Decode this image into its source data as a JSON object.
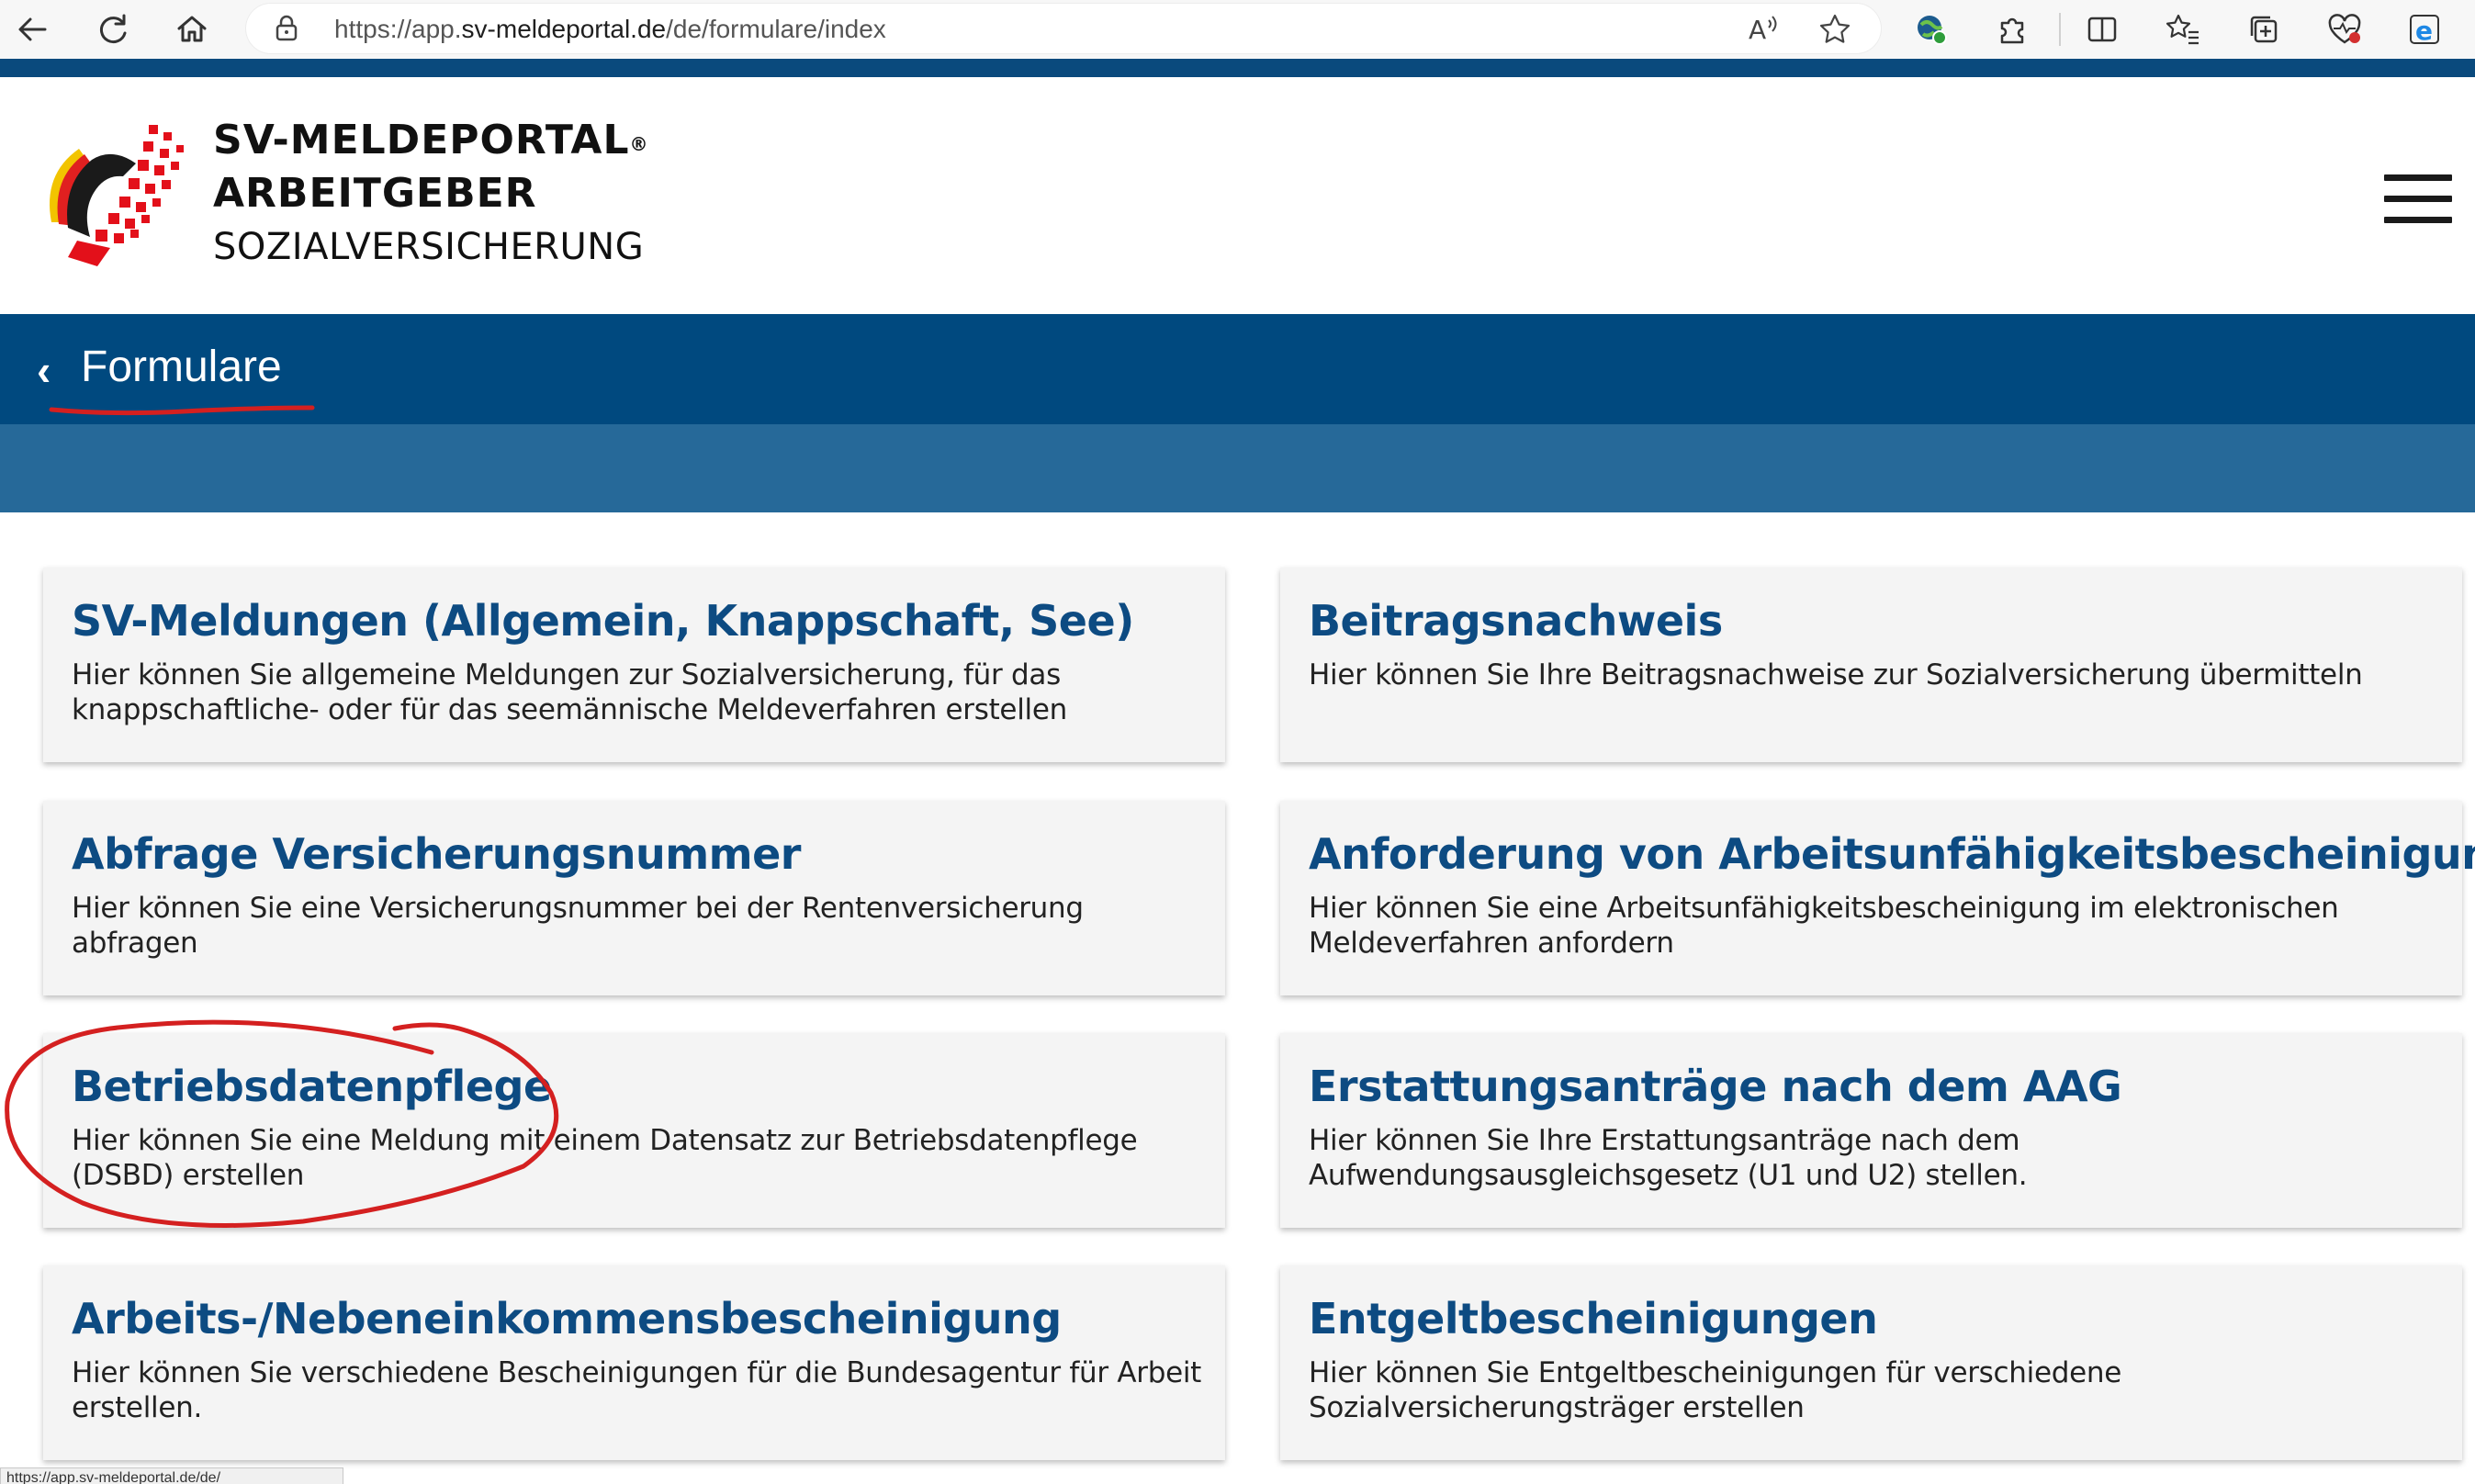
{
  "browser": {
    "url_base": "https://app.",
    "url_host": "sv-meldeportal.de",
    "url_path": "/de/formulare/index",
    "status_url": "https://app.sv-meldeportal.de/de/"
  },
  "header": {
    "brand_line1": "SV-MELDEPORTAL",
    "brand_reg": "®",
    "brand_line2": "ARBEITGEBER",
    "brand_line3": "SOZIALVERSICHERUNG"
  },
  "title_band": {
    "title": "Formulare"
  },
  "cards": [
    {
      "title": "SV-Meldungen (Allgemein, Knappschaft, See)",
      "desc": "Hier können Sie allgemeine Meldungen zur Sozialversicherung, für das knappschaftliche- oder für das seemännische Meldeverfahren erstellen"
    },
    {
      "title": "Beitragsnachweis",
      "desc": "Hier können Sie Ihre Beitragsnachweise zur Sozialversicherung übermitteln"
    },
    {
      "title": "Abfrage Versicherungsnummer",
      "desc": "Hier können Sie eine Versicherungsnummer bei der Rentenversicherung abfragen"
    },
    {
      "title": "Anforderung von Arbeitsunfähigkeitsbescheinigungen",
      "desc": "Hier können Sie eine Arbeitsunfähigkeitsbescheinigung im elektronischen Meldeverfahren anfordern"
    },
    {
      "title": "Betriebsdatenpflege",
      "desc": "Hier können Sie eine Meldung mit einem Datensatz zur Betriebsdatenpflege (DSBD) erstellen"
    },
    {
      "title": "Erstattungsanträge nach dem AAG",
      "desc": "Hier können Sie Ihre Erstattungsanträge nach dem Aufwendungsausgleichsgesetz (U1 und U2) stellen."
    },
    {
      "title": "Arbeits-/Nebeneinkommensbescheinigung",
      "desc": "Hier können Sie verschiedene Bescheinigungen für die Bundesagentur für Arbeit erstellen."
    },
    {
      "title": "Entgeltbescheinigungen",
      "desc": "Hier können Sie Entgeltbescheinigungen für verschiedene Sozialversicherungsträger erstellen"
    }
  ],
  "colors": {
    "title_band": "#00497f",
    "sub_band": "#266999",
    "card_title": "#0d4b82",
    "annotation": "#d42020"
  }
}
